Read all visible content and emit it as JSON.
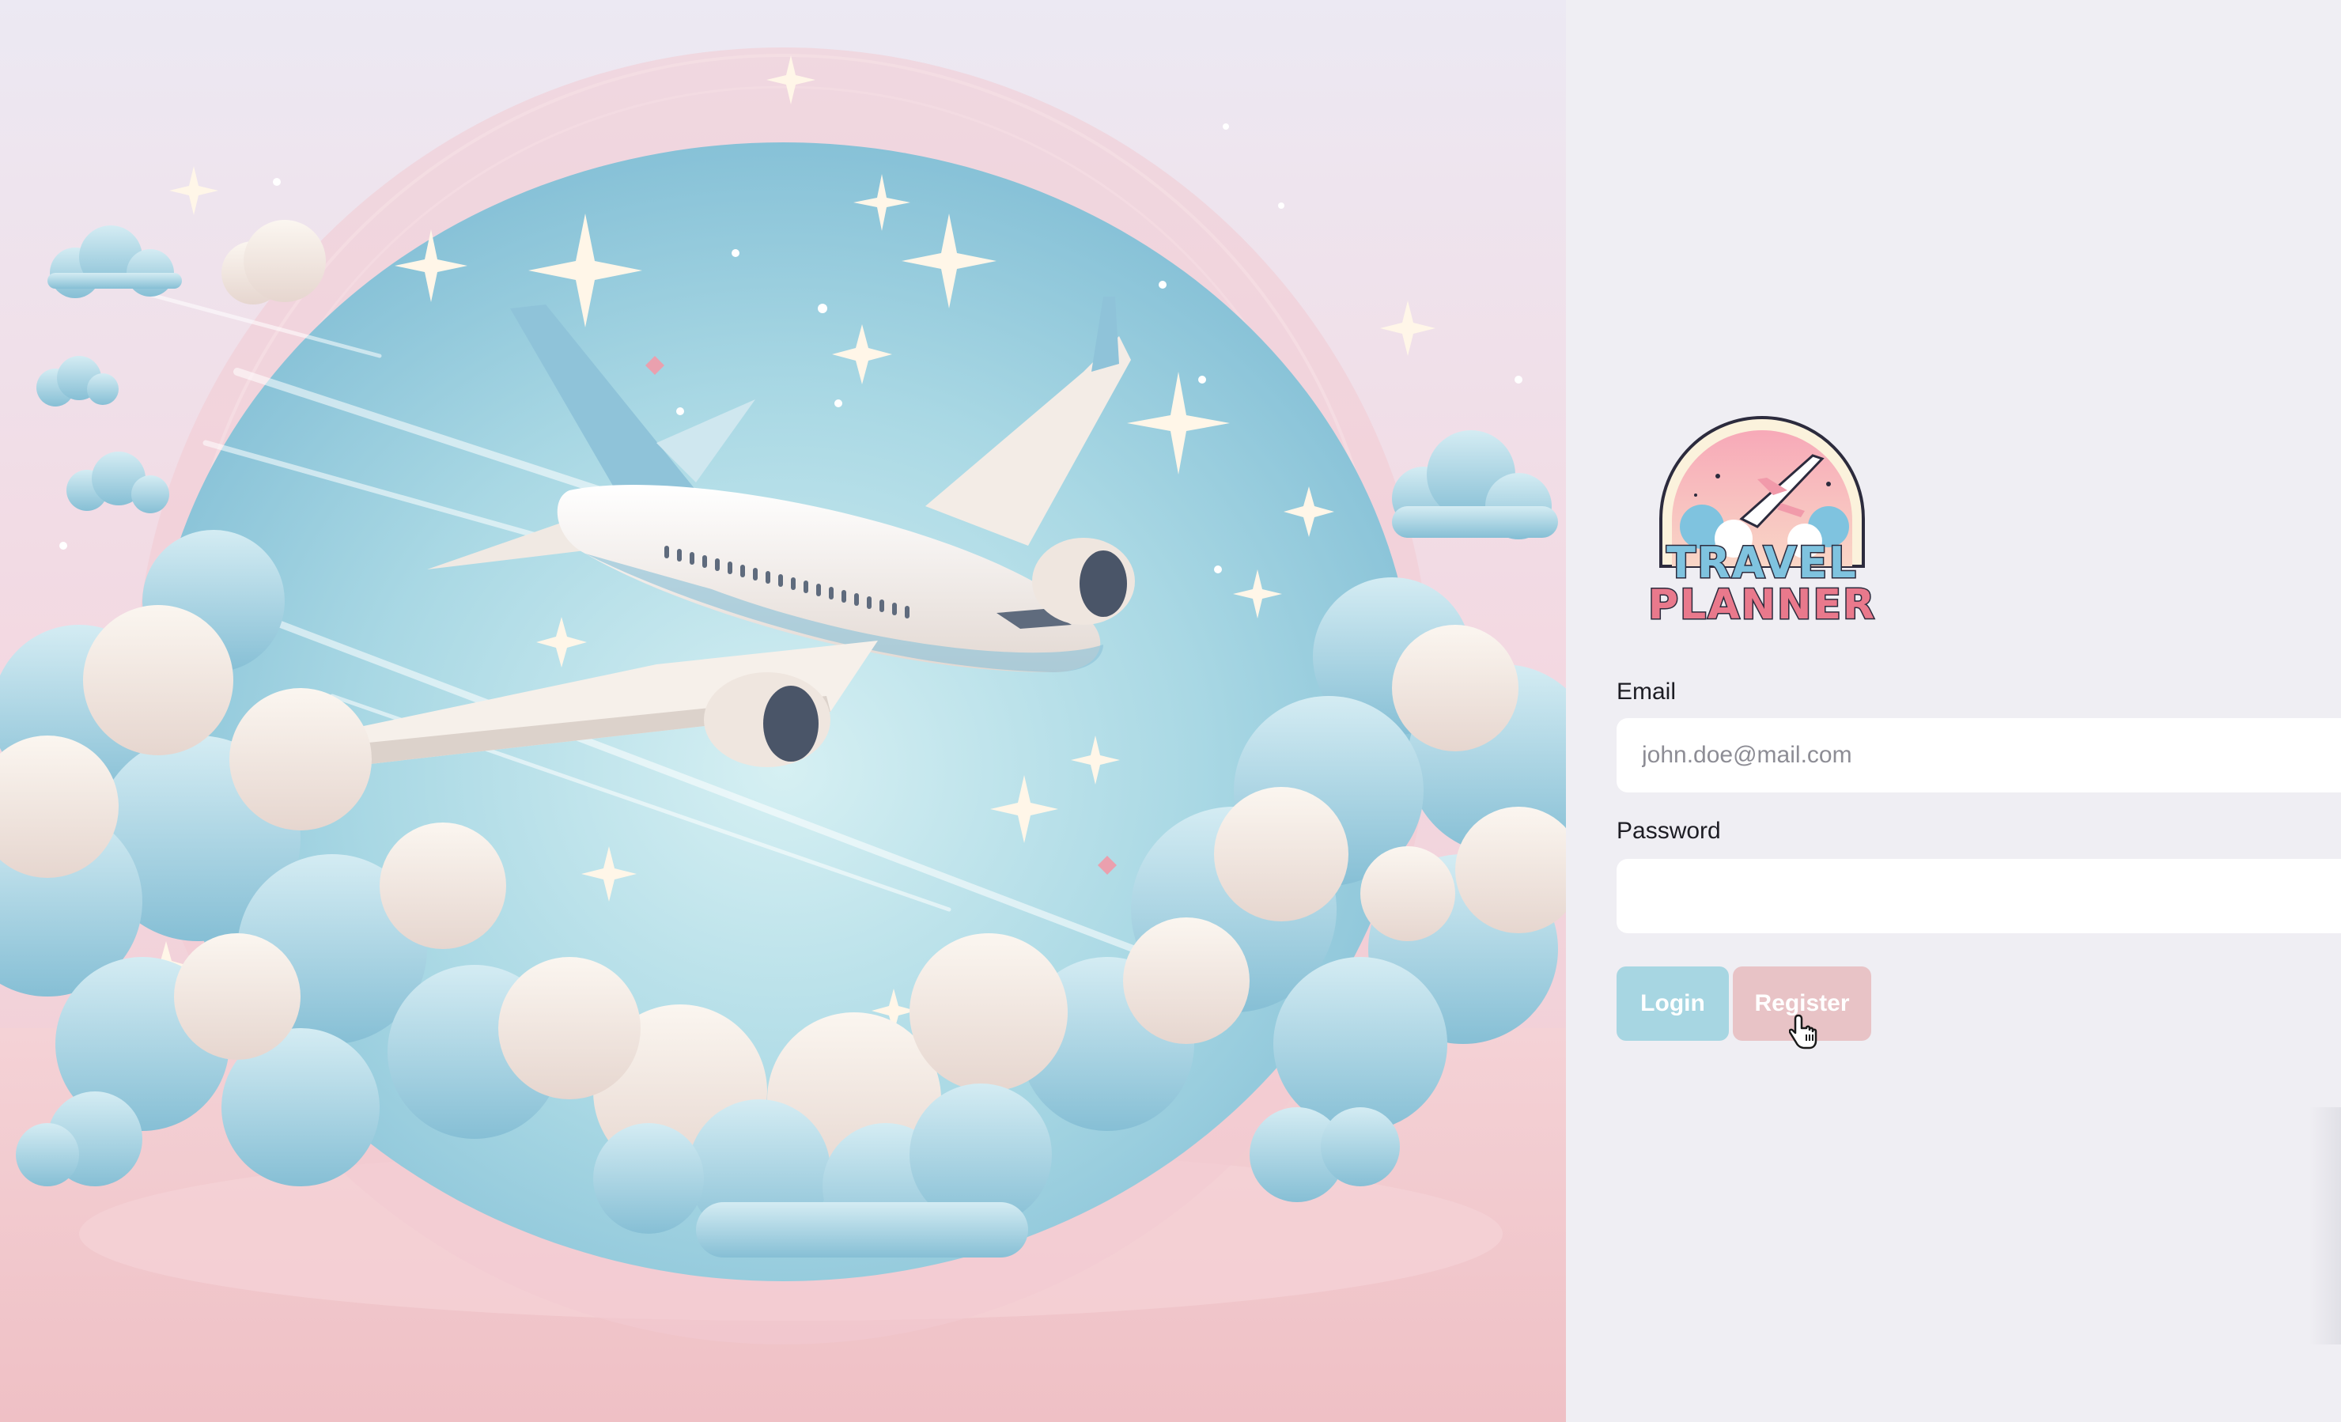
{
  "hero": {
    "image_name": "airplane-clouds-illustration",
    "colors": {
      "sky": "#9fd3e0",
      "sky_light": "#cdeaf0",
      "pink_bg": "#f1c9cf",
      "cloud_blue": "#a9d4e2",
      "cloud_cream": "#f4e9e3",
      "plane_body": "#f5efe9",
      "plane_accent": "#8fc3d9"
    }
  },
  "logo": {
    "line1": "TRAVEL",
    "line2": "PLANNER",
    "colors": {
      "line1": "#7fc3df",
      "line2": "#e9798c",
      "outline": "#2c2b3d"
    }
  },
  "form": {
    "email_label": "Email",
    "email_placeholder": "john.doe@mail.com",
    "email_value": "",
    "password_label": "Password",
    "password_value": "",
    "login_label": "Login",
    "register_label": "Register"
  },
  "colors": {
    "panel_bg": "#efeef3",
    "login_button": "#a7d6e2",
    "register_button": "#e8c3c6"
  }
}
